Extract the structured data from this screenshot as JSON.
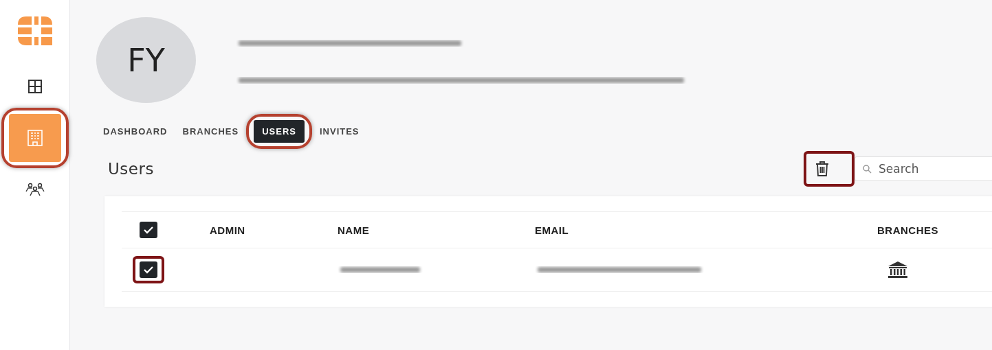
{
  "sidebar": {
    "items": [
      {
        "kind": "grid",
        "selected": false,
        "highlighted": false
      },
      {
        "kind": "building",
        "selected": true,
        "highlighted": true
      },
      {
        "kind": "people",
        "selected": false,
        "highlighted": false
      }
    ]
  },
  "profile": {
    "initials": "FY"
  },
  "tabs": [
    {
      "label": "DASHBOARD",
      "selected": false,
      "highlighted": false
    },
    {
      "label": "BRANCHES",
      "selected": false,
      "highlighted": false
    },
    {
      "label": "USERS",
      "selected": true,
      "highlighted": true
    },
    {
      "label": "INVITES",
      "selected": false,
      "highlighted": false
    }
  ],
  "heading": "Users",
  "toolbar": {
    "delete_highlighted": true,
    "search": {
      "placeholder": "Search"
    }
  },
  "table": {
    "header_checked": true,
    "columns": [
      "ADMIN",
      "NAME",
      "EMAIL",
      "BRANCHES"
    ],
    "rows": [
      {
        "checked": true,
        "highlighted": true
      }
    ]
  }
}
